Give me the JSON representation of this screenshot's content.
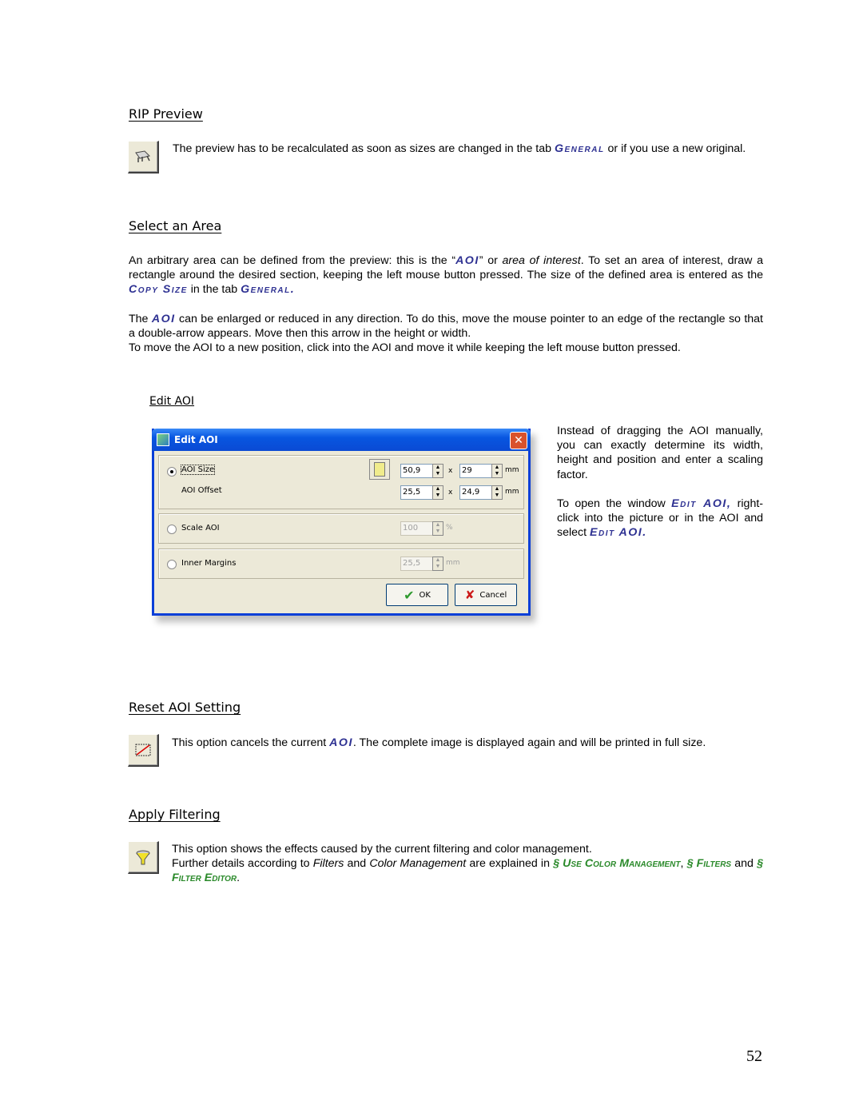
{
  "sections": {
    "rip_preview": {
      "heading": "RIP Preview",
      "icon": "rip-preview-icon",
      "text_before": "The preview has to be recalculated as soon as sizes are changed in the tab ",
      "kw_general": "General",
      "text_after": " or if you use a new original."
    },
    "select_area": {
      "heading": "Select an Area",
      "p1_a": "An arbitrary area can be defined from the preview: this is the “",
      "p1_aoi": "AOI",
      "p1_b": "” or ",
      "p1_italic": "area of interest",
      "p1_c": ". To set an area of interest, draw a rectangle around the desired section, keeping the left mouse button pressed. The size of the defined area is entered as the ",
      "p1_copysize": "Copy Size",
      "p1_d": " in the tab ",
      "p1_general": "General.",
      "p2_a": "The ",
      "p2_aoi": "AOI",
      "p2_b": " can be enlarged or reduced in any direction. To do this, move the mouse pointer to an edge of the rectangle so that a double-arrow appears. Move then this arrow in the height or width.",
      "p3": "To move the AOI to a new position, click into the AOI and move it while keeping the left mouse button pressed."
    },
    "edit_aoi": {
      "subheading": "Edit AOI",
      "side_p1": "Instead of dragging the AOI manually, you can exactly determine its width, height and position and enter a scaling factor.",
      "side_p2_a": "To open the window ",
      "side_p2_kw1": "Edit AOI,",
      "side_p2_b": " right-click into the picture or in the AOI and select ",
      "side_p2_kw2": "Edit AOI."
    },
    "reset_aoi": {
      "heading": "Reset AOI Setting",
      "icon": "reset-aoi-icon",
      "text_a": "This option cancels the current ",
      "kw_aoi": "AOI",
      "text_b": ". The complete image is displayed again and will be printed in full size."
    },
    "apply_filtering": {
      "heading": "Apply Filtering",
      "icon": "filter-funnel-icon",
      "line1": "This option shows the effects caused by the current filtering and color management.",
      "l2_a": "Further details according to ",
      "l2_filters": "Filters",
      "l2_b": " and ",
      "l2_cm": "Color Management",
      "l2_c": " are explained in ",
      "l2_link1": "§ Use Color Management",
      "l2_d": ", ",
      "l2_link2": "§ Filters",
      "l2_e": " and ",
      "l2_link3": "§ Filter Editor",
      "l2_f": "."
    }
  },
  "dialog": {
    "title": "Edit AOI",
    "aoi_size_label": "AOI Size",
    "aoi_offset_label": "AOI Offset",
    "size_w": "50,9",
    "size_h": "29",
    "offset_x": "25,5",
    "offset_y": "24,9",
    "times": "x",
    "unit_mm": "mm",
    "scale_label": "Scale AOI",
    "scale_value": "100",
    "unit_pct": "%",
    "margins_label": "Inner Margins",
    "margins_value": "25,5",
    "ok_label": "OK",
    "cancel_label": "Cancel",
    "selected_option": "AOI Size"
  },
  "page_number": "52"
}
